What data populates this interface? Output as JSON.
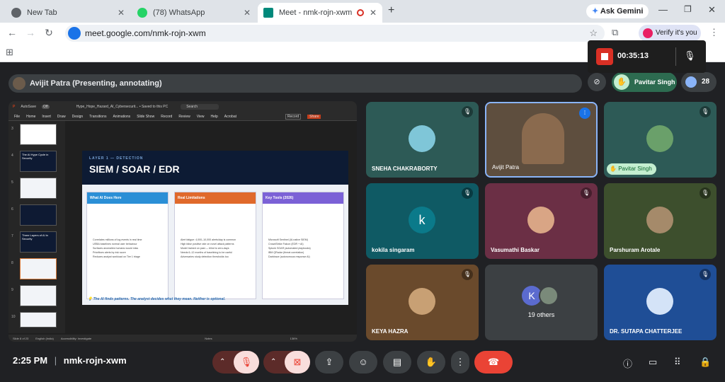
{
  "tabs": [
    {
      "title": "New Tab"
    },
    {
      "title": "(78) WhatsApp"
    },
    {
      "title": "Meet - nmk-rojn-xwm"
    }
  ],
  "browser": {
    "url": "meet.google.com/nmk-rojn-xwm",
    "ask_gemini": "Ask Gemini",
    "verify": "Verify it's you",
    "new_tab": "+"
  },
  "recording": {
    "timer": "00:35:13"
  },
  "presenter": {
    "label": "Avijit Patra (Presenting, annotating)"
  },
  "top_right": {
    "raised_hand_name": "Pavitar Singh",
    "participant_count": "28"
  },
  "ppt": {
    "autosave": "AutoSave",
    "autosave_state": "Off",
    "file_title": "Hype_Hope_Hazard_AI_Cybersecurit... • Saved to this PC",
    "search": "Search",
    "menu": [
      "File",
      "Home",
      "Insert",
      "Draw",
      "Design",
      "Transitions",
      "Animations",
      "Slide Show",
      "Record",
      "Review",
      "View",
      "Help",
      "Acrobat"
    ],
    "record_btn": "Record",
    "share_btn": "Share",
    "thumb_numbers": [
      "3",
      "4",
      "5",
      "6",
      "7",
      "8",
      "9",
      "10"
    ],
    "thumb_titles": [
      "",
      "The AI Hype Cycle in Security",
      "",
      "",
      "Three Layers of AI in Security",
      "",
      "",
      ""
    ],
    "status_slide": "Slide 8 of 23",
    "status_lang": "English (India)",
    "status_access": "Accessibility: Investigate",
    "status_notes": "Notes",
    "status_zoom": "136%"
  },
  "slide": {
    "layer": "LAYER 1 — DETECTION",
    "title": "SIEM / SOAR / EDR",
    "cards": [
      {
        "head": "What AI Does Here",
        "color": "#2b8fd6",
        "items": [
          "Correlates millions of log events in real time",
          "UEBA baselines normal user behaviour",
          "Surfaces anomalies humans would miss",
          "Prioritises alerts by risk score",
          "Reduces analyst workload on Tier 1 triage"
        ]
      },
      {
        "head": "Real Limitations",
        "color": "#e0692b",
        "items": [
          "Alert fatigue: 4,000–10,000 alerts/day is common",
          "High false positive rate on novel attack patterns",
          "Model trained on past — blind to zero-days",
          "Needs 6–12 months of baselining to be useful",
          "Adversaries study detection thresholds too"
        ]
      },
      {
        "head": "Key Tools (2026)",
        "color": "#7b61d6",
        "items": [
          "Microsoft Sentinel (AI-native SIEM)",
          "CrowdStrike Falcon (EDR + AI)",
          "Splunk SOAR (automated playbooks)",
          "IBM QRadar (threat correlation)",
          "Darktrace (autonomous response AI)"
        ]
      }
    ],
    "footer": "The AI finds patterns. The analyst decides what they mean. Neither is optional."
  },
  "participants": [
    {
      "name": "SNEHA CHAKRABORTY",
      "bg": "#2d5a56",
      "avatar_color": "#7fc6d8",
      "muted": true
    },
    {
      "name": "Avijit Patra",
      "bg": "#5e4e3e",
      "avatar_color": "#8a6a4e",
      "muted": false,
      "speaking": true
    },
    {
      "name": "Pavitar Singh",
      "bg": "#2d5a56",
      "avatar_color": "#6aa06a",
      "muted": true,
      "hand": true
    },
    {
      "name": "kokila singaram",
      "bg": "#0f5a64",
      "avatar_color": "#0b7a8a",
      "muted": true,
      "initial": "k"
    },
    {
      "name": "Vasumathi Baskar",
      "bg": "#6b2f45",
      "avatar_color": "#d9a585",
      "muted": true
    },
    {
      "name": "Parshuram Arotale",
      "bg": "#3d4f2d",
      "avatar_color": "#a58a6a",
      "muted": true
    },
    {
      "name": "KEYA HAZRA",
      "bg": "#6a4a2c",
      "avatar_color": "#c8a074",
      "muted": true
    },
    {
      "name": "19 others",
      "bg": "#3c4043",
      "avatar_color": "#5b6bcf",
      "muted": false,
      "initial": "K"
    },
    {
      "name": "DR. SUTAPA CHATTERJEE",
      "bg": "#1f4e96",
      "avatar_color": "#d4e3f7",
      "muted": true
    }
  ],
  "bottom": {
    "time": "2:25 PM",
    "separator": "|",
    "meeting_code": "nmk-rojn-xwm"
  }
}
